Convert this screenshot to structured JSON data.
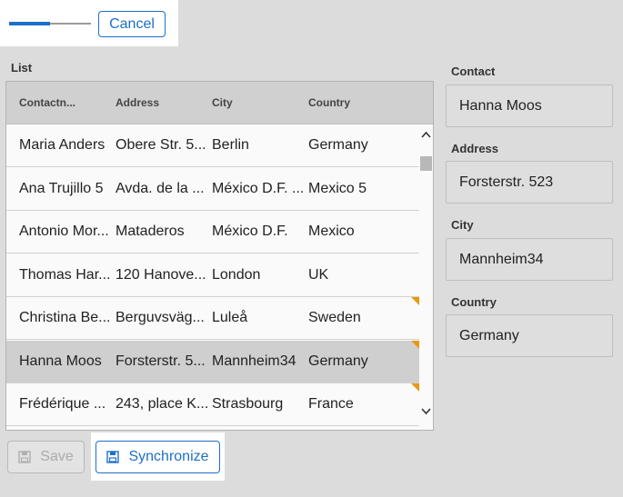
{
  "toolbar": {
    "progress_fraction": 0.5,
    "cancel_label": "Cancel"
  },
  "list": {
    "label": "List",
    "columns": [
      "Contactn...",
      "Address",
      "City",
      "Country"
    ],
    "rows": [
      {
        "name": "Maria Anders",
        "address": "Obere Str. 5...",
        "city": "Berlin",
        "country": "Germany",
        "flag": false,
        "selected": false
      },
      {
        "name": "Ana Trujillo 5",
        "address": "Avda. de la ...",
        "city": "México D.F. ...",
        "country": "Mexico 5",
        "flag": false,
        "selected": false
      },
      {
        "name": "Antonio Mor...",
        "address": "Mataderos",
        "city": "México D.F.",
        "country": "Mexico",
        "flag": false,
        "selected": false
      },
      {
        "name": "Thomas Har...",
        "address": "120 Hanove...",
        "city": "London",
        "country": "UK",
        "flag": false,
        "selected": false
      },
      {
        "name": "Christina Be...",
        "address": "Berguvsväg...",
        "city": "Luleå",
        "country": "Sweden",
        "flag": true,
        "selected": false
      },
      {
        "name": "Hanna Moos",
        "address": "Forsterstr. 5...",
        "city": "Mannheim34",
        "country": "Germany",
        "flag": true,
        "selected": true
      },
      {
        "name": "Frédérique ...",
        "address": "243, place K...",
        "city": "Strasbourg",
        "country": "France",
        "flag": true,
        "selected": false
      }
    ]
  },
  "details": {
    "contact": {
      "label": "Contact",
      "value": "Hanna Moos"
    },
    "address": {
      "label": "Address",
      "value": "Forsterstr. 523"
    },
    "city": {
      "label": "City",
      "value": "Mannheim34"
    },
    "country": {
      "label": "Country",
      "value": "Germany"
    }
  },
  "actions": {
    "save_label": "Save",
    "sync_label": "Synchronize"
  },
  "colors": {
    "accent": "#1d6fc9",
    "flag": "#e59b12",
    "selected_row": "#cfcfcf"
  }
}
